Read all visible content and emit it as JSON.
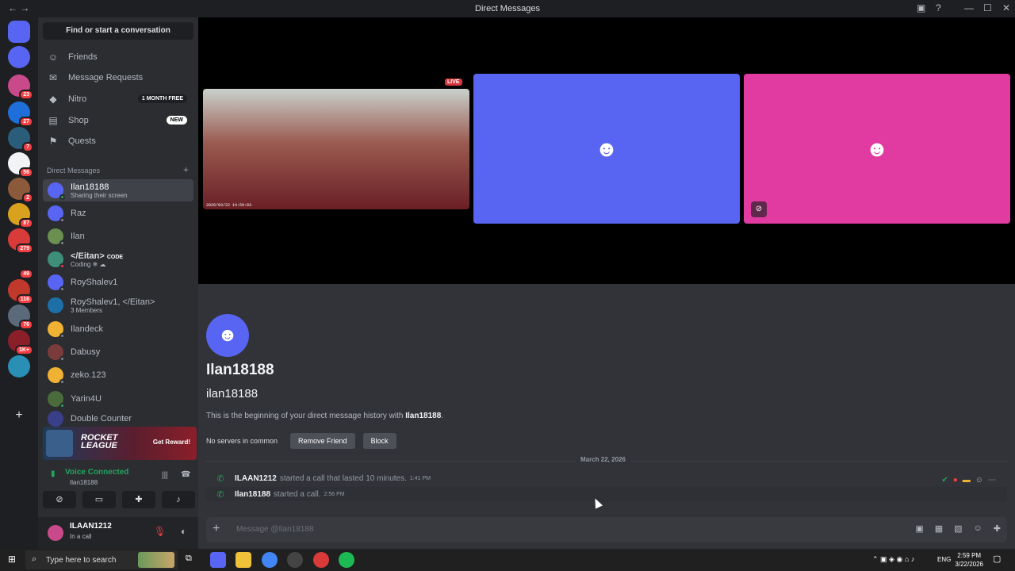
{
  "window": {
    "title": "Direct Messages"
  },
  "sidebar": {
    "search_label": "Find or start a conversation",
    "nav": [
      {
        "label": "Friends",
        "icon": "friends-icon"
      },
      {
        "label": "Message Requests",
        "icon": "envelope-icon"
      },
      {
        "label": "Nitro",
        "icon": "nitro-icon",
        "pill": "1 MONTH FREE"
      },
      {
        "label": "Shop",
        "icon": "shop-icon",
        "pill": "NEW"
      },
      {
        "label": "Quests",
        "icon": "quests-icon"
      }
    ],
    "dm_header": "Direct Messages",
    "dms": [
      {
        "name": "Ilan18188",
        "sub": "Sharing their screen",
        "color": "#5865f2"
      },
      {
        "name": "Raz",
        "color": "#5865f2"
      },
      {
        "name": "Ilan",
        "color": "#6a8f4e"
      },
      {
        "name": "</Eitan>",
        "tag": "CODE",
        "sub": "Coding ❄ ☁",
        "color": "#3e8f7a"
      },
      {
        "name": "RoyShalev1",
        "color": "#5865f2"
      },
      {
        "name": "RoyShalev1, </Eitan>",
        "sub": "3 Members",
        "color": "#1e6fa8"
      },
      {
        "name": "Ilandeck",
        "color": "#f0b232"
      },
      {
        "name": "Dabusy",
        "color": "#7a3b3b"
      },
      {
        "name": "zeko.123",
        "color": "#f0b232"
      },
      {
        "name": "Yarin4U",
        "color": "#4a6b3c"
      },
      {
        "name": "Double Counter",
        "color": "#3a3f8a"
      }
    ]
  },
  "guild_badges": [
    "23",
    "27",
    "7",
    "56",
    "2",
    "87",
    "279",
    "49",
    "116",
    "76",
    "1K+"
  ],
  "promo": {
    "game": "ROCKET LEAGUE",
    "cta": "Get Reward!"
  },
  "voice": {
    "status": "Voice Connected",
    "channel": "Ilan18188"
  },
  "user": {
    "name": "ILAAN1212",
    "status": "In a call"
  },
  "stage": {
    "live_badge": "LIVE",
    "timestamp": "2026/03/22 14:59:03",
    "tile2_color": "#5865f2",
    "tile3_color": "#e13aa0"
  },
  "profile": {
    "display_name": "Ilan18188",
    "username": "ilan18188",
    "begin_prefix": "This is the beginning of your direct message history with ",
    "begin_name": "Ilan18188",
    "no_servers": "No servers in common",
    "remove_friend": "Remove Friend",
    "block": "Block"
  },
  "messages": {
    "date_divider": "March 22, 2026",
    "items": [
      {
        "who": "ILAAN1212",
        "text": "started a call that lasted 10 minutes.",
        "time": "1:41 PM"
      },
      {
        "who": "Ilan18188",
        "text": "started a call.",
        "time": "2:56 PM"
      }
    ]
  },
  "composer": {
    "placeholder": "Message @Ilan18188"
  },
  "taskbar": {
    "search": "Type here to search",
    "lang": "ENG",
    "time": "2:59 PM",
    "date": "3/22/2026"
  }
}
